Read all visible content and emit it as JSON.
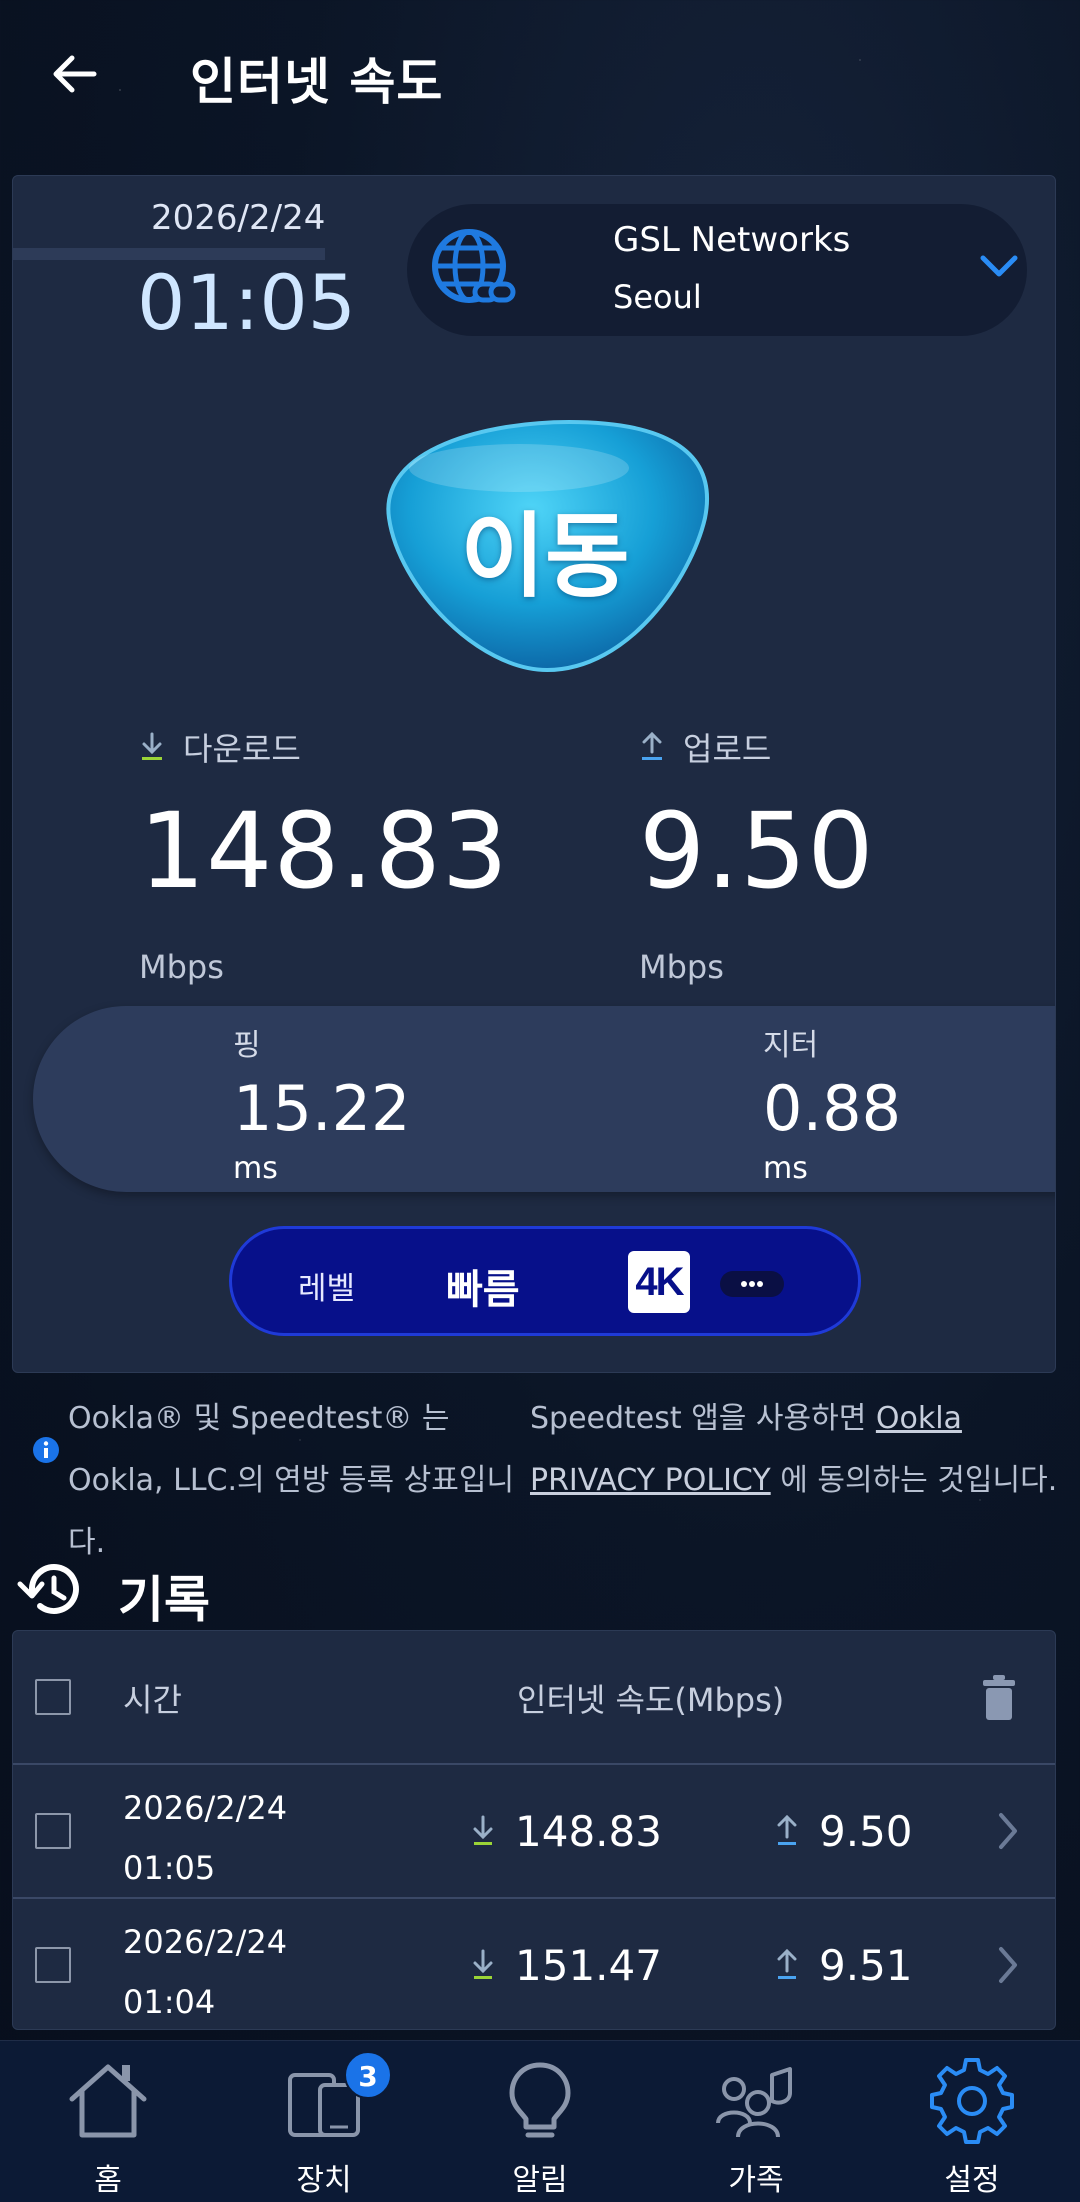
{
  "header": {
    "title": "인터넷 속도",
    "back_icon": "arrow-left-icon"
  },
  "result": {
    "date": "2026/2/24",
    "time": "01:05",
    "server_name": "GSL Networks",
    "server_city": "Seoul",
    "go_label": "이동",
    "download": {
      "label": "다운로드",
      "value": "148.83",
      "unit": "Mbps",
      "arrow_color": "#9bd437"
    },
    "upload": {
      "label": "업로드",
      "value": "9.50",
      "unit": "Mbps",
      "arrow_color": "#4aa3f0"
    },
    "ping": {
      "label": "핑",
      "value": "15.22",
      "unit": "ms"
    },
    "jitter": {
      "label": "지터",
      "value": "0.88",
      "unit": "ms"
    },
    "level": {
      "label": "레벨",
      "value": "빠름",
      "badge": "4K"
    }
  },
  "info": {
    "left_text": "Ookla® 및 Speedtest® 는 Ookla, LLC.의 연방 등록 상표입니다.",
    "right_prefix": "Speedtest 앱을 사용하면 ",
    "link_text": "Ookla PRIVACY POLICY",
    "right_suffix": " 에 동의하는 것입니다."
  },
  "history": {
    "title": "기록",
    "col_time": "시간",
    "col_speed": "인터넷 속도(Mbps)",
    "rows": [
      {
        "date": "2026/2/24",
        "time": "01:05",
        "download": "148.83",
        "upload": "9.50"
      },
      {
        "date": "2026/2/24",
        "time": "01:04",
        "download": "151.47",
        "upload": "9.51"
      }
    ]
  },
  "nav": {
    "items": [
      {
        "label": "홈",
        "icon": "home-icon"
      },
      {
        "label": "장치",
        "icon": "devices-icon",
        "badge": "3"
      },
      {
        "label": "알림",
        "icon": "lightbulb-icon"
      },
      {
        "label": "가족",
        "icon": "family-icon"
      },
      {
        "label": "설정",
        "icon": "settings-icon",
        "active": true
      }
    ]
  },
  "colors": {
    "accent": "#1a73e8",
    "active_nav": "#2a8cf5",
    "level_bg": "#07108a",
    "card_bg": "#1e2a42"
  }
}
